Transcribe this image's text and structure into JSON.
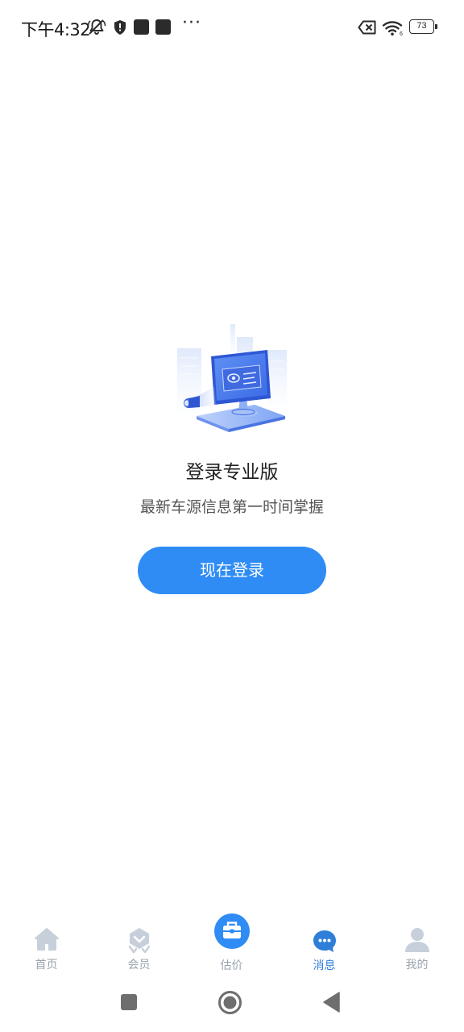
{
  "status_bar": {
    "time": "下午4:32",
    "battery_level": "73",
    "icons": [
      "muted-bell-icon",
      "shield-icon",
      "notification-square-icon",
      "notification-square-icon",
      "more-dots-icon",
      "data-off-icon",
      "wifi-icon",
      "battery-icon"
    ],
    "more_glyph": "···"
  },
  "empty_state": {
    "illustration": "monitor-with-projector-illustration",
    "title": "登录专业版",
    "subtitle": "最新车源信息第一时间掌握",
    "button_label": "现在登录"
  },
  "tab_bar": {
    "items": [
      {
        "label": "首页",
        "icon": "home-icon",
        "active": false
      },
      {
        "label": "会员",
        "icon": "member-badge-icon",
        "active": false
      },
      {
        "label": "估价",
        "icon": "briefcase-icon",
        "active": false
      },
      {
        "label": "消息",
        "icon": "chat-bubble-icon",
        "active": true
      },
      {
        "label": "我的",
        "icon": "user-icon",
        "active": false
      }
    ]
  },
  "nav_bar": {
    "buttons": [
      "recents-button",
      "home-button",
      "back-button"
    ]
  },
  "colors": {
    "accent": "#2f8cf5",
    "active_tab": "#2f7fd8",
    "inactive_tab": "#9aa3ad",
    "tab_icon_inactive": "#c7d0da"
  }
}
